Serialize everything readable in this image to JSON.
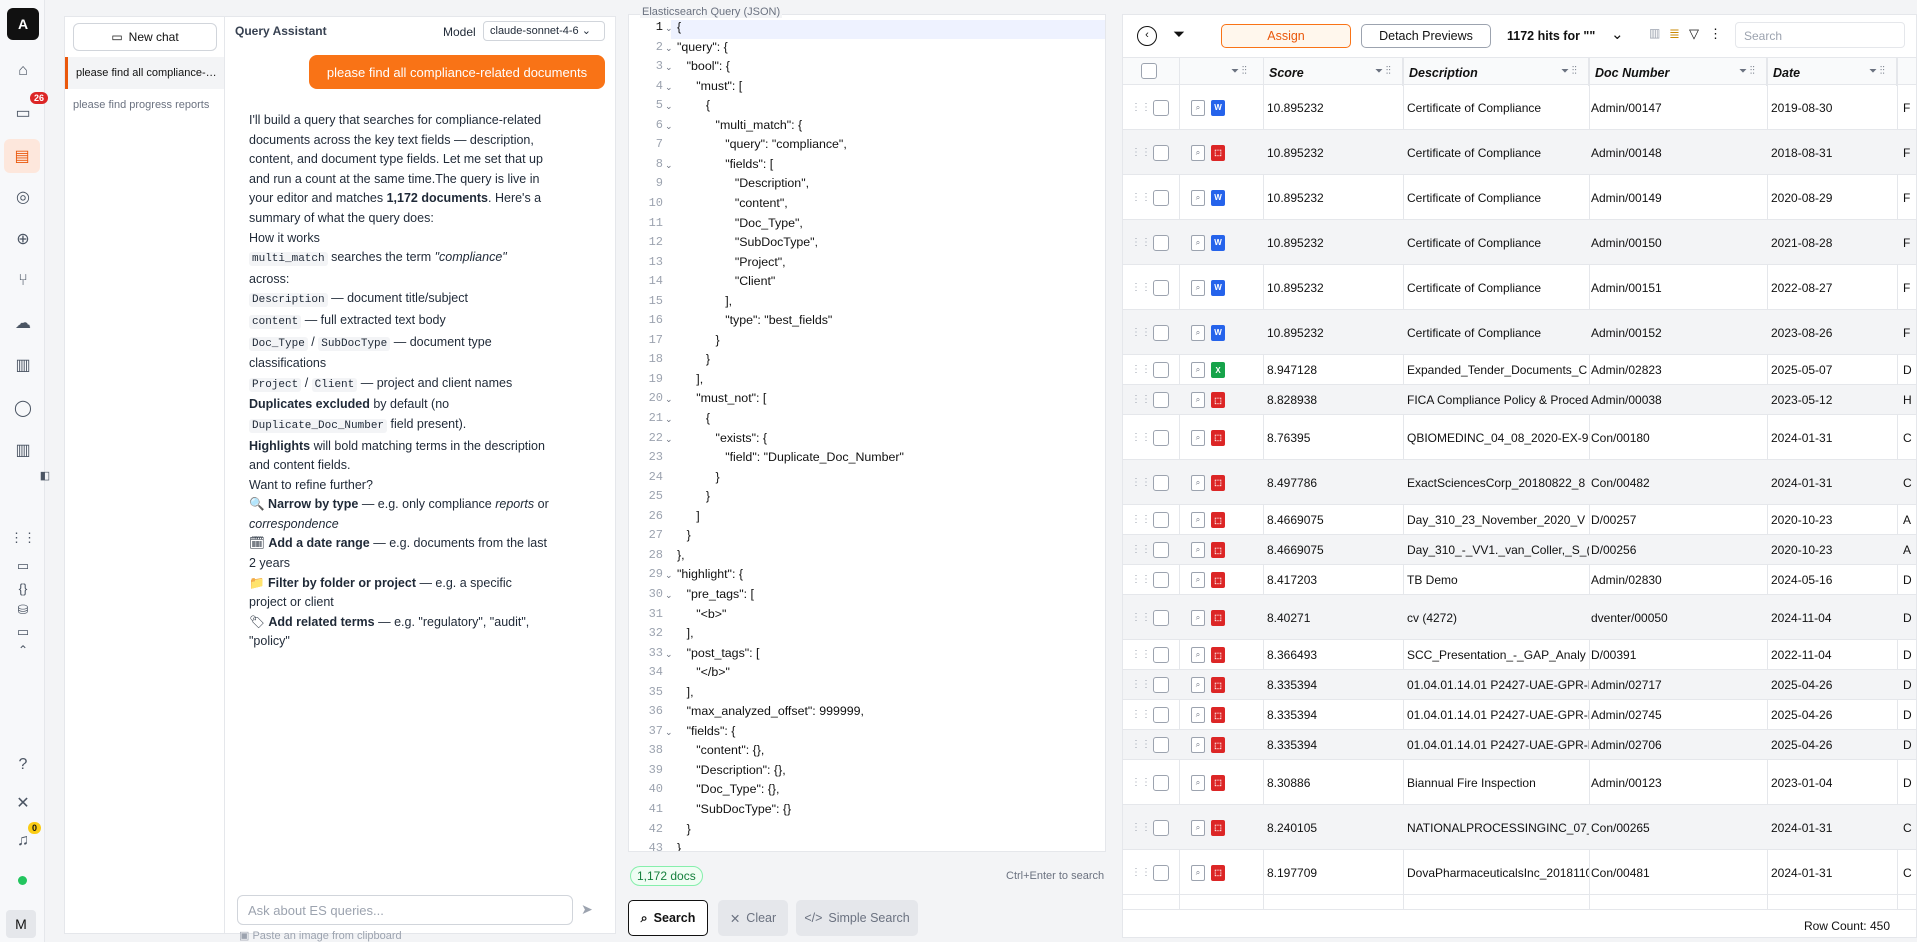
{
  "rail": {
    "logo": "A",
    "inbox_badge": "26",
    "notif_badge": "0",
    "avatar": "M"
  },
  "history": {
    "new_chat": "New chat",
    "items": [
      "please find all compliance-related documents",
      "please find progress reports"
    ]
  },
  "chat": {
    "title": "Query Assistant",
    "model_label": "Model",
    "model_value": "claude-sonnet-4-6",
    "user_message": "please find all compliance-related documents",
    "input_placeholder": "Ask about ES queries...",
    "paste_hint": "Paste an image from clipboard"
  },
  "editor": {
    "label": "Elasticsearch Query (JSON)",
    "doc_count": "1,172 docs",
    "shortcut": "Ctrl+Enter to search",
    "search_btn": "Search",
    "clear_btn": "Clear",
    "simple_btn": "Simple Search"
  },
  "grid": {
    "assign": "Assign",
    "detach": "Detach Previews",
    "hits": "1172 hits for \"\"",
    "search_placeholder": "Search",
    "columns": [
      "Score",
      "Description",
      "Doc Number",
      "Date"
    ],
    "row_count": "Row Count: 450",
    "rows": [
      {
        "score": "10.895232",
        "desc": "Certificate of Compliance",
        "doc": "Admin/00147",
        "date": "2019-08-30",
        "type": "doc",
        "tail": "F"
      },
      {
        "score": "10.895232",
        "desc": "Certificate of Compliance",
        "doc": "Admin/00148",
        "date": "2018-08-31",
        "type": "pdf",
        "tail": "F"
      },
      {
        "score": "10.895232",
        "desc": "Certificate of Compliance",
        "doc": "Admin/00149",
        "date": "2020-08-29",
        "type": "doc",
        "tail": "F"
      },
      {
        "score": "10.895232",
        "desc": "Certificate of Compliance",
        "doc": "Admin/00150",
        "date": "2021-08-28",
        "type": "doc",
        "tail": "F"
      },
      {
        "score": "10.895232",
        "desc": "Certificate of Compliance",
        "doc": "Admin/00151",
        "date": "2022-08-27",
        "type": "doc",
        "tail": "F"
      },
      {
        "score": "10.895232",
        "desc": "Certificate of Compliance",
        "doc": "Admin/00152",
        "date": "2023-08-26",
        "type": "doc",
        "tail": "F"
      },
      {
        "score": "8.947128",
        "desc": "Expanded_Tender_Documents_C",
        "doc": "Admin/02823",
        "date": "2025-05-07",
        "type": "xls",
        "tail": "D"
      },
      {
        "score": "8.828938",
        "desc": "FICA Compliance Policy & Procedu",
        "doc": "Admin/00038",
        "date": "2023-05-12",
        "type": "pdf",
        "tail": "H"
      },
      {
        "score": "8.76395",
        "desc": "QBIOMEDINC_04_08_2020-EX-9",
        "doc": "Con/00180",
        "date": "2024-01-31",
        "type": "pdf",
        "tail": "C"
      },
      {
        "score": "8.497786",
        "desc": "ExactSciencesCorp_20180822_8",
        "doc": "Con/00482",
        "date": "2024-01-31",
        "type": "pdf",
        "tail": "C"
      },
      {
        "score": "8.4669075",
        "desc": "Day_310_23_November_2020_V",
        "doc": "D/00257",
        "date": "2020-10-23",
        "type": "pdf",
        "tail": "A"
      },
      {
        "score": "8.4669075",
        "desc": "Day_310_-_VV1._van_Coller,_S_(2",
        "doc": "D/00256",
        "date": "2020-10-23",
        "type": "pdf",
        "tail": "A"
      },
      {
        "score": "8.417203",
        "desc": "TB Demo",
        "doc": "Admin/02830",
        "date": "2024-05-16",
        "type": "pdf",
        "tail": "D"
      },
      {
        "score": "8.40271",
        "desc": "cv (4272)",
        "doc": "dventer/00050",
        "date": "2024-11-04",
        "type": "pdf",
        "tail": "D"
      },
      {
        "score": "8.366493",
        "desc": "SCC_Presentation_-_GAP_Analy",
        "doc": "D/00391",
        "date": "2022-11-04",
        "type": "pdf",
        "tail": "D"
      },
      {
        "score": "8.335394",
        "desc": "01.04.01.14.01 P2427-UAE-GPR-F",
        "doc": "Admin/02717",
        "date": "2025-04-26",
        "type": "pdf",
        "tail": "D"
      },
      {
        "score": "8.335394",
        "desc": "01.04.01.14.01 P2427-UAE-GPR-F",
        "doc": "Admin/02745",
        "date": "2025-04-26",
        "type": "pdf",
        "tail": "D"
      },
      {
        "score": "8.335394",
        "desc": "01.04.01.14.01 P2427-UAE-GPR-F",
        "doc": "Admin/02706",
        "date": "2025-04-26",
        "type": "pdf",
        "tail": "D"
      },
      {
        "score": "8.30886",
        "desc": "Biannual Fire Inspection",
        "doc": "Admin/00123",
        "date": "2023-01-04",
        "type": "pdf",
        "tail": "D"
      },
      {
        "score": "8.240105",
        "desc": "NATIONALPROCESSINGINC_07_1",
        "doc": "Con/00265",
        "date": "2024-01-31",
        "type": "pdf",
        "tail": "C"
      },
      {
        "score": "8.197709",
        "desc": "DovaPharmaceuticalsInc_2018110",
        "doc": "Con/00481",
        "date": "2024-01-31",
        "type": "pdf",
        "tail": "C"
      }
    ]
  }
}
